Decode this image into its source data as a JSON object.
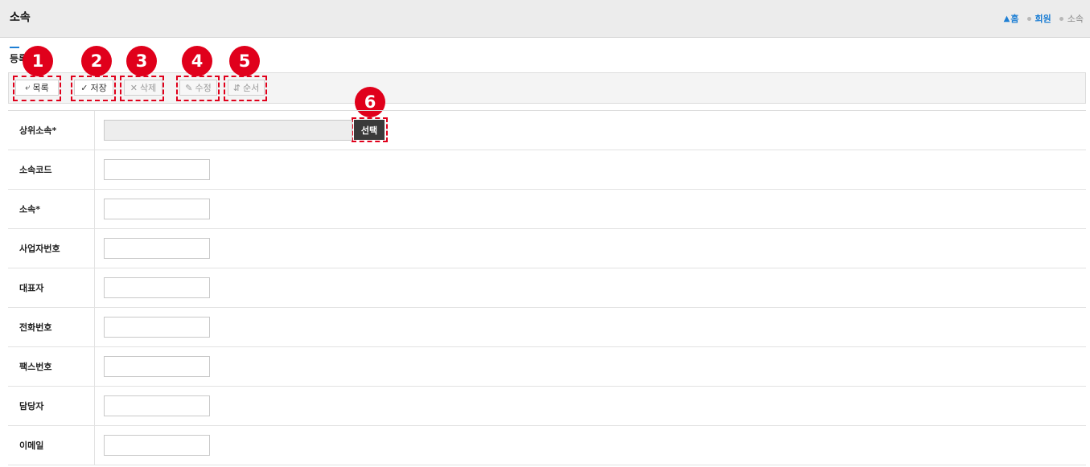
{
  "header": {
    "title": "소속",
    "breadcrumb": {
      "home_icon": "home-icon",
      "home": "홈",
      "member": "회원",
      "current": "소속"
    }
  },
  "section": {
    "title": "등록"
  },
  "toolbar": {
    "list_label": "목록",
    "save_label": "저장",
    "delete_label": "삭제",
    "edit_label": "수정",
    "order_label": "순서"
  },
  "badges": [
    "1",
    "2",
    "3",
    "4",
    "5",
    "6"
  ],
  "form": {
    "select_button_label": "선택",
    "fields": [
      {
        "label": "상위소속*",
        "value": ""
      },
      {
        "label": "소속코드",
        "value": ""
      },
      {
        "label": "소속*",
        "value": ""
      },
      {
        "label": "사업자번호",
        "value": ""
      },
      {
        "label": "대표자",
        "value": ""
      },
      {
        "label": "전화번호",
        "value": ""
      },
      {
        "label": "팩스번호",
        "value": ""
      },
      {
        "label": "담당자",
        "value": ""
      },
      {
        "label": "이메일",
        "value": ""
      }
    ]
  },
  "colors": {
    "accent": "#1e7fd4",
    "highlight": "#e0001b",
    "dark_button": "#3a3a3a"
  }
}
